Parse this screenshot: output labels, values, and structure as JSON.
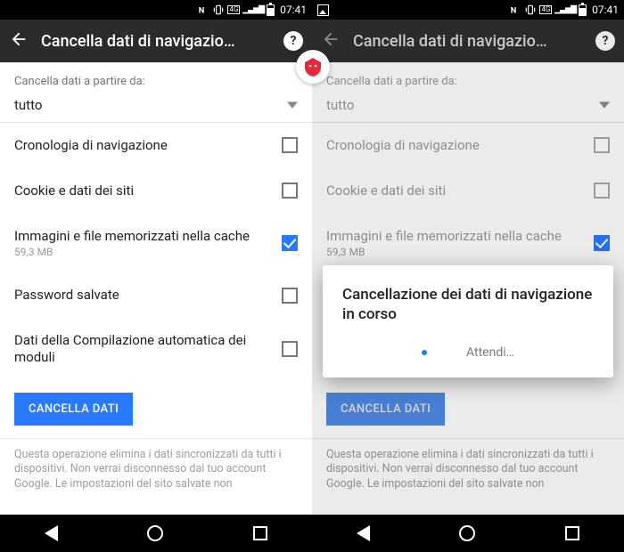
{
  "status": {
    "time": "07:41"
  },
  "appbar": {
    "title": "Cancella dati di navigazio…",
    "help_label": "?"
  },
  "form": {
    "range_label": "Cancella dati a partire da:",
    "range_value": "tutto",
    "clear_button": "CANCELLA DATI"
  },
  "items": [
    {
      "label": "Cronologia di navigazione",
      "sub": "",
      "checked": false
    },
    {
      "label": "Cookie e dati dei siti",
      "sub": "",
      "checked": false
    },
    {
      "label": "Immagini e file memorizzati nella cache",
      "sub": "59,3 MB",
      "checked": true
    },
    {
      "label": "Password salvate",
      "sub": "",
      "checked": false
    },
    {
      "label": "Dati della Compilazione automatica dei moduli",
      "sub": "",
      "checked": false
    }
  ],
  "footer_note": "Questa operazione elimina i dati sincronizzati da tutti i dispositivi. Non verrai disconnesso dal tuo account Google. Le impostazioni del sito salvate non",
  "modal": {
    "title": "Cancellazione dei dati di navigazione in corso",
    "wait": "Attendi…"
  }
}
